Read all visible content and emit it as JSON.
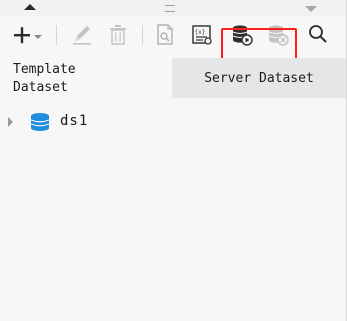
{
  "colors": {
    "highlight": "#ff1e1e",
    "db_icon": "#1e8fe0",
    "active_tab_bg": "#e6e6e6"
  },
  "toolbar": {
    "buttons": [
      {
        "name": "add",
        "icon": "plus-icon",
        "enabled": true
      },
      {
        "name": "edit",
        "icon": "pencil-icon",
        "enabled": false
      },
      {
        "name": "delete",
        "icon": "trash-icon",
        "enabled": false
      },
      {
        "name": "preview",
        "icon": "document-preview-icon",
        "enabled": false
      },
      {
        "name": "parameters",
        "icon": "dataset-params-icon",
        "enabled": true
      },
      {
        "name": "server-dataset-connect",
        "icon": "database-play-icon",
        "enabled": true
      },
      {
        "name": "server-dataset-remove",
        "icon": "database-remove-icon",
        "enabled": false
      },
      {
        "name": "search",
        "icon": "search-icon",
        "enabled": true
      }
    ]
  },
  "tabs": {
    "template": {
      "line1": "Template",
      "line2": "Dataset"
    },
    "server": {
      "label": "Server Dataset"
    }
  },
  "tree": {
    "items": [
      {
        "label": "ds1",
        "icon": "database-icon",
        "expanded": false
      }
    ]
  }
}
